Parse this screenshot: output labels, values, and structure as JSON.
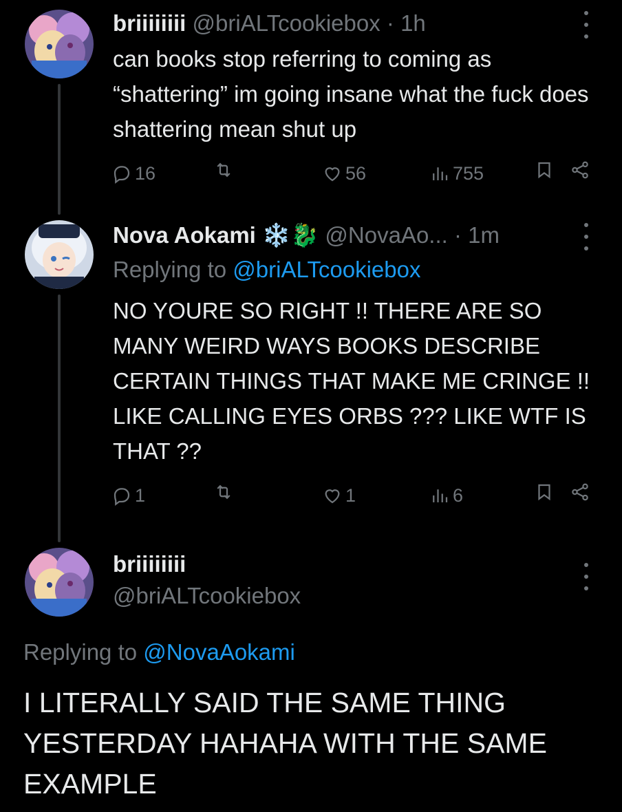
{
  "tweets": [
    {
      "name": "briiiiiiii",
      "handle": "@briALTcookiebox",
      "dot": "·",
      "time": "1h",
      "text": "can books stop referring to coming as “shattering” im going insane what the fuck does shattering mean shut up",
      "replies": "16",
      "retweets": "",
      "likes": "56",
      "views": "755"
    },
    {
      "name": "Nova Aokami",
      "emoji": "❄️🐉",
      "handle": "@NovaAo...",
      "dot": "·",
      "time": "1m",
      "replying_label": "Replying to",
      "replying_to": "@briALTcookiebox",
      "text": "NO YOURE SO RIGHT !! THERE ARE SO MANY WEIRD WAYS BOOKS DESCRIBE CERTAIN THINGS THAT MAKE ME CRINGE !! LIKE CALLING EYES ORBS ??? LIKE WTF IS THAT ??",
      "replies": "1",
      "retweets": "",
      "likes": "1",
      "views": "6"
    }
  ],
  "focused_tweet": {
    "name": "briiiiiiii",
    "handle": "@briALTcookiebox",
    "replying_label": "Replying to",
    "replying_to": "@NovaAokami",
    "text": "I LITERALLY SAID THE SAME THING YESTERDAY HAHAHA WITH THE SAME EXAMPLE"
  },
  "icons": {
    "reply": "reply-icon",
    "retweet": "retweet-icon",
    "like": "heart-icon",
    "views": "views-icon",
    "bookmark": "bookmark-icon",
    "share": "share-icon",
    "more": "more-icon"
  },
  "colors": {
    "background": "#000000",
    "text": "#e7e9ea",
    "secondary": "#71767b",
    "link": "#1d9bf0",
    "thread_line": "#333639"
  }
}
